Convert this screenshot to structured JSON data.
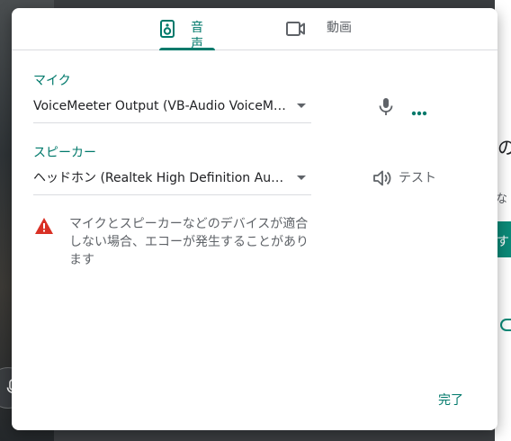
{
  "tabs": [
    {
      "label": "音声",
      "icon": "speaker-icon",
      "active": true
    },
    {
      "label": "動画",
      "icon": "videocam-icon",
      "active": false
    }
  ],
  "microphone": {
    "section_label": "マイク",
    "selected": "VoiceMeeter Output (VB-Audio VoiceMe..."
  },
  "speaker": {
    "section_label": "スピーカー",
    "selected": "ヘッドホン (Realtek High Definition Audi...",
    "test_label": "テスト"
  },
  "warning": {
    "text": "マイクとスピーカーなどのデバイスが適合しない場合、エコーが発生することがあります"
  },
  "actions": {
    "done_label": "完了"
  },
  "background": {
    "right_heading_fragment": "の",
    "right_text_fragment": "な",
    "right_button_fragment": "す"
  },
  "colors": {
    "accent": "#00796b",
    "warning": "#d93025",
    "text_primary": "#202124",
    "text_secondary": "#5f6368"
  }
}
